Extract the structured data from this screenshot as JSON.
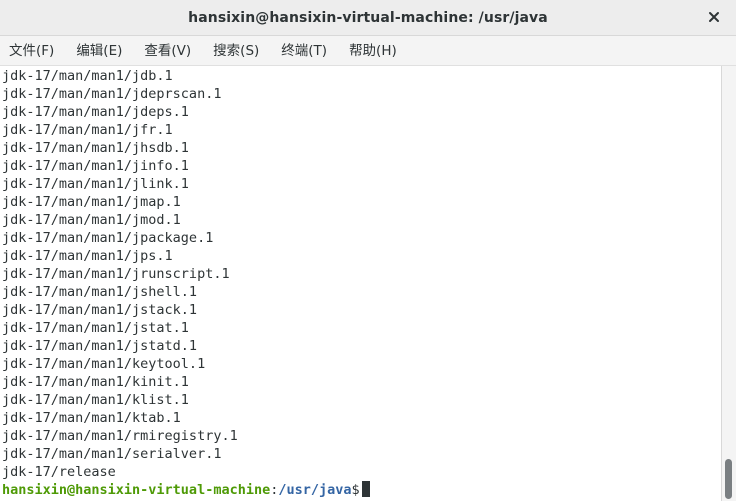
{
  "window": {
    "title": "hansixin@hansixin-virtual-machine: /usr/java"
  },
  "menu": {
    "items": [
      {
        "label": "文件(F)"
      },
      {
        "label": "编辑(E)"
      },
      {
        "label": "查看(V)"
      },
      {
        "label": "搜索(S)"
      },
      {
        "label": "终端(T)"
      },
      {
        "label": "帮助(H)"
      }
    ]
  },
  "terminal": {
    "lines": [
      "jdk-17/man/man1/jdb.1",
      "jdk-17/man/man1/jdeprscan.1",
      "jdk-17/man/man1/jdeps.1",
      "jdk-17/man/man1/jfr.1",
      "jdk-17/man/man1/jhsdb.1",
      "jdk-17/man/man1/jinfo.1",
      "jdk-17/man/man1/jlink.1",
      "jdk-17/man/man1/jmap.1",
      "jdk-17/man/man1/jmod.1",
      "jdk-17/man/man1/jpackage.1",
      "jdk-17/man/man1/jps.1",
      "jdk-17/man/man1/jrunscript.1",
      "jdk-17/man/man1/jshell.1",
      "jdk-17/man/man1/jstack.1",
      "jdk-17/man/man1/jstat.1",
      "jdk-17/man/man1/jstatd.1",
      "jdk-17/man/man1/keytool.1",
      "jdk-17/man/man1/kinit.1",
      "jdk-17/man/man1/klist.1",
      "jdk-17/man/man1/ktab.1",
      "jdk-17/man/man1/rmiregistry.1",
      "jdk-17/man/man1/serialver.1",
      "jdk-17/release"
    ],
    "prompt": {
      "user_host": "hansixin@hansixin-virtual-machine",
      "separator": ":",
      "path": "/usr/java",
      "symbol": "$"
    }
  },
  "colors": {
    "prompt_user": "#4e9a06",
    "prompt_path": "#3465a4",
    "text": "#2e3436",
    "background": "#ffffff"
  },
  "icons": {
    "close": "close-icon"
  }
}
